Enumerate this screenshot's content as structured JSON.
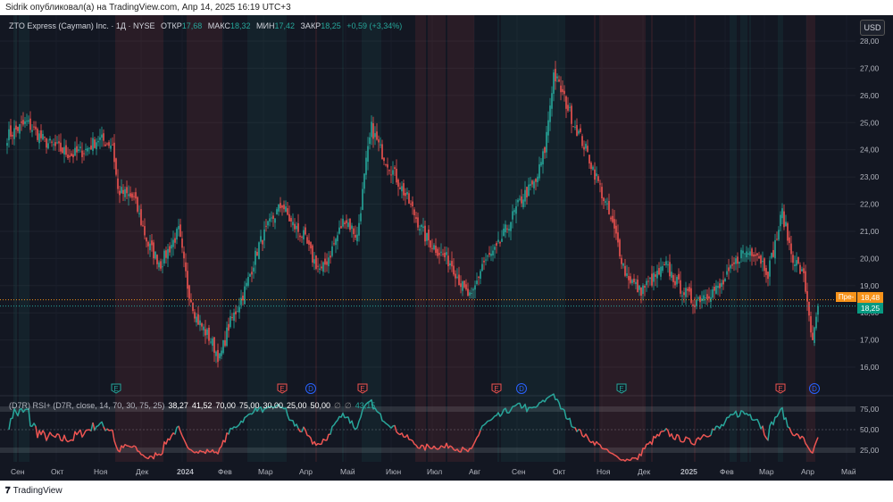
{
  "header": {
    "published": "Sidrik опубликовал(а) на TradingView.com, Апр 14, 2025 16:19 UTC+3"
  },
  "legend": {
    "symbol": "ZTO Express (Cayman) Inc. · 1Д · NYSE",
    "open_label": "ОТКР",
    "open": "17,68",
    "high_label": "МАКС",
    "high": "18,32",
    "low_label": "МИН",
    "low": "17,42",
    "close_label": "ЗАКР",
    "close": "18,25",
    "change": "+0,59 (+3,34%)"
  },
  "currency": "USD",
  "price_axis": [
    "28,00",
    "27,00",
    "26,00",
    "25,00",
    "24,00",
    "23,00",
    "22,00",
    "21,00",
    "20,00",
    "19,00",
    "18,00",
    "17,00",
    "16,00"
  ],
  "price_labels": {
    "pre_label": "Пре-",
    "pre_value": "18,48",
    "last_value": "18,25"
  },
  "rsi": {
    "title": "(D7R) RSI+ (D7R, close, 14, 70, 30, 75, 25)",
    "values": [
      "38,27",
      "41,52",
      "70,00",
      "75,00",
      "30,00",
      "25,00",
      "50,00",
      "∅",
      "∅"
    ],
    "last": "43,15",
    "axis": [
      "75,00",
      "50,00",
      "25,00"
    ]
  },
  "time_axis": [
    "Сен",
    "Окт",
    "Ноя",
    "Дек",
    "2024",
    "Фев",
    "Мар",
    "Апр",
    "Май",
    "Июн",
    "Июл",
    "Авг",
    "Сен",
    "Окт",
    "Ноя",
    "Дек",
    "2025",
    "Фев",
    "Мар",
    "Апр",
    "Май"
  ],
  "colors": {
    "up": "#26a69a",
    "down": "#ef5350",
    "bg": "#131722",
    "accent": "#f7931a"
  },
  "chart_data": {
    "type": "candlestick",
    "price_range": [
      15.5,
      28.5
    ],
    "anchors": [
      [
        0,
        24.5
      ],
      [
        11,
        25.0
      ],
      [
        21,
        24.3
      ],
      [
        36,
        23.8
      ],
      [
        44,
        24
      ],
      [
        51,
        24.4
      ],
      [
        59,
        24.2
      ],
      [
        62,
        22.5
      ],
      [
        71,
        22.2
      ],
      [
        79,
        20.5
      ],
      [
        86,
        19.8
      ],
      [
        96,
        21
      ],
      [
        101,
        19
      ],
      [
        106,
        17.8
      ],
      [
        114,
        17
      ],
      [
        119,
        16.3
      ],
      [
        124,
        17.5
      ],
      [
        129,
        18.2
      ],
      [
        134,
        19
      ],
      [
        141,
        20.5
      ],
      [
        149,
        21.5
      ],
      [
        154,
        22
      ],
      [
        159,
        21.3
      ],
      [
        166,
        20.8
      ],
      [
        171,
        20
      ],
      [
        176,
        19.5
      ],
      [
        181,
        20.2
      ],
      [
        189,
        21.5
      ],
      [
        196,
        20.8
      ],
      [
        201,
        23.5
      ],
      [
        204,
        24.8
      ],
      [
        209,
        24
      ],
      [
        216,
        23.2
      ],
      [
        224,
        22.2
      ],
      [
        229,
        21.5
      ],
      [
        234,
        20.8
      ],
      [
        241,
        20.3
      ],
      [
        249,
        19.8
      ],
      [
        256,
        18.8
      ],
      [
        260,
        18.5
      ],
      [
        266,
        19.8
      ],
      [
        274,
        20.3
      ],
      [
        281,
        21.3
      ],
      [
        289,
        22.3
      ],
      [
        296,
        22.8
      ],
      [
        301,
        24
      ],
      [
        306,
        26.8
      ],
      [
        310,
        26.2
      ],
      [
        316,
        25.2
      ],
      [
        324,
        24
      ],
      [
        331,
        22.8
      ],
      [
        336,
        21.8
      ],
      [
        341,
        20.8
      ],
      [
        346,
        19.5
      ],
      [
        354,
        18.8
      ],
      [
        361,
        19.2
      ],
      [
        369,
        19.7
      ],
      [
        376,
        19
      ],
      [
        384,
        18.4
      ],
      [
        391,
        18.7
      ],
      [
        399,
        18.9
      ],
      [
        404,
        19.4
      ],
      [
        411,
        20.2
      ],
      [
        419,
        20.3
      ],
      [
        426,
        19.5
      ],
      [
        431,
        20.8
      ],
      [
        434,
        21.7
      ],
      [
        439,
        20.2
      ],
      [
        446,
        19.3
      ],
      [
        449,
        18
      ],
      [
        451,
        16.8
      ],
      [
        454,
        18.25
      ]
    ],
    "events": [
      {
        "day": 61,
        "type": "E",
        "result": "beat"
      },
      {
        "day": 344,
        "type": "E",
        "result": "beat"
      },
      {
        "day": 154,
        "type": "E",
        "result": "miss"
      },
      {
        "day": 199,
        "type": "E",
        "result": "miss"
      },
      {
        "day": 274,
        "type": "E",
        "result": "miss"
      },
      {
        "day": 433,
        "type": "E",
        "result": "miss"
      },
      {
        "day": 170,
        "type": "D"
      },
      {
        "day": 288,
        "type": "D"
      },
      {
        "day": 452,
        "type": "D"
      }
    ]
  }
}
